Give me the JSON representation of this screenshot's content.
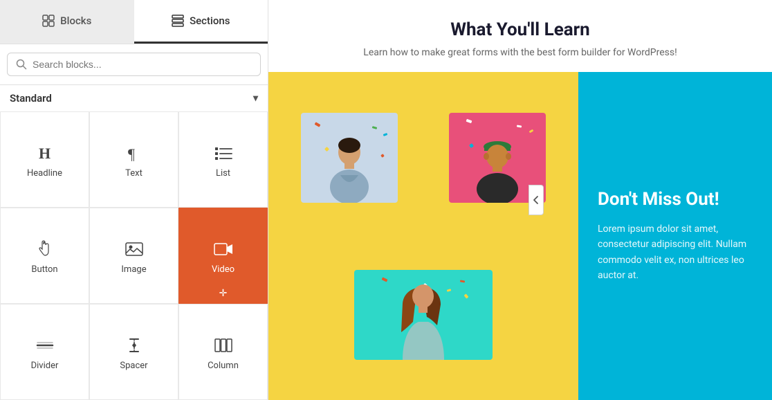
{
  "tabs": [
    {
      "id": "blocks",
      "label": "Blocks",
      "icon": "blocks-icon",
      "active": false
    },
    {
      "id": "sections",
      "label": "Sections",
      "icon": "sections-icon",
      "active": true
    }
  ],
  "search": {
    "placeholder": "Search blocks...",
    "value": ""
  },
  "standard_section": {
    "label": "Standard",
    "chevron": "▾"
  },
  "blocks": [
    {
      "id": "headline",
      "label": "Headline",
      "icon": "H",
      "active": false
    },
    {
      "id": "text",
      "label": "Text",
      "icon": "¶",
      "active": false
    },
    {
      "id": "list",
      "label": "List",
      "icon": "list",
      "active": false
    },
    {
      "id": "button",
      "label": "Button",
      "icon": "button",
      "active": false
    },
    {
      "id": "image",
      "label": "Image",
      "icon": "image",
      "active": false
    },
    {
      "id": "video",
      "label": "Video",
      "icon": "video",
      "active": true
    },
    {
      "id": "divider",
      "label": "Divider",
      "icon": "divider",
      "active": false
    },
    {
      "id": "spacer",
      "label": "Spacer",
      "icon": "spacer",
      "active": false
    },
    {
      "id": "column",
      "label": "Column",
      "icon": "column",
      "active": false
    }
  ],
  "main": {
    "learn_title": "What You'll Learn",
    "learn_subtitle": "Learn how to make great forms with the best form builder for WordPress!",
    "dont_miss_title": "Don't Miss Out!",
    "dont_miss_text": "Lorem ipsum dolor sit amet, consectetur adipiscing elit. Nullam commodo velit ex, non ultrices leo auctor at."
  },
  "colors": {
    "active_block_bg": "#e05a2b",
    "yellow_area": "#f5d442",
    "blue_area": "#00b4d8",
    "learn_title": "#1a1a2e"
  }
}
